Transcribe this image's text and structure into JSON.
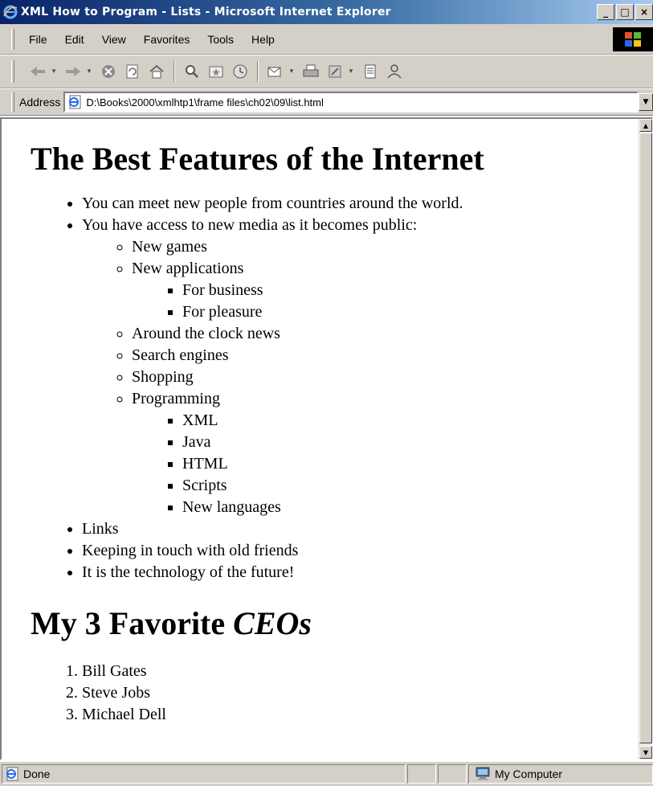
{
  "window": {
    "title": "XML How to Program - Lists - Microsoft Internet Explorer",
    "minimize": "_",
    "maximize": "□",
    "close": "×"
  },
  "menu": {
    "items": [
      "File",
      "Edit",
      "View",
      "Favorites",
      "Tools",
      "Help"
    ]
  },
  "toolbar": {
    "buttons": [
      "back-icon",
      "forward-icon",
      "stop-icon",
      "refresh-icon",
      "home-icon",
      "search-icon",
      "favorites-icon",
      "history-icon",
      "mail-icon",
      "print-icon",
      "edit-icon",
      "discuss-icon",
      "messenger-icon"
    ]
  },
  "address": {
    "label": "Address",
    "value": "D:\\Books\\2000\\xmlhtp1\\frame files\\ch02\\09\\list.html"
  },
  "page": {
    "heading1": "The Best Features of the Internet",
    "features": [
      "You can meet new people from countries around the world.",
      "You have access to new media as it becomes public:"
    ],
    "media": {
      "new_games": "New games",
      "new_applications": "New applications",
      "applications": [
        "For business",
        "For pleasure"
      ],
      "others": [
        "Around the clock news",
        "Search engines",
        "Shopping",
        "Programming"
      ],
      "programming": [
        "XML",
        "Java",
        "HTML",
        "Scripts",
        "New languages"
      ]
    },
    "more_features": [
      "Links",
      "Keeping in touch with old friends",
      "It is the technology of the future!"
    ],
    "heading2_prefix": "My 3 Favorite ",
    "heading2_emph": "CEOs",
    "ceos": [
      "Bill Gates",
      "Steve Jobs",
      "Michael Dell"
    ]
  },
  "status": {
    "text": "Done",
    "zone": "My Computer"
  },
  "colors": {
    "title_gradient_start": "#0a246a",
    "title_gradient_end": "#a6caf0",
    "chrome": "#d4d0c8"
  }
}
